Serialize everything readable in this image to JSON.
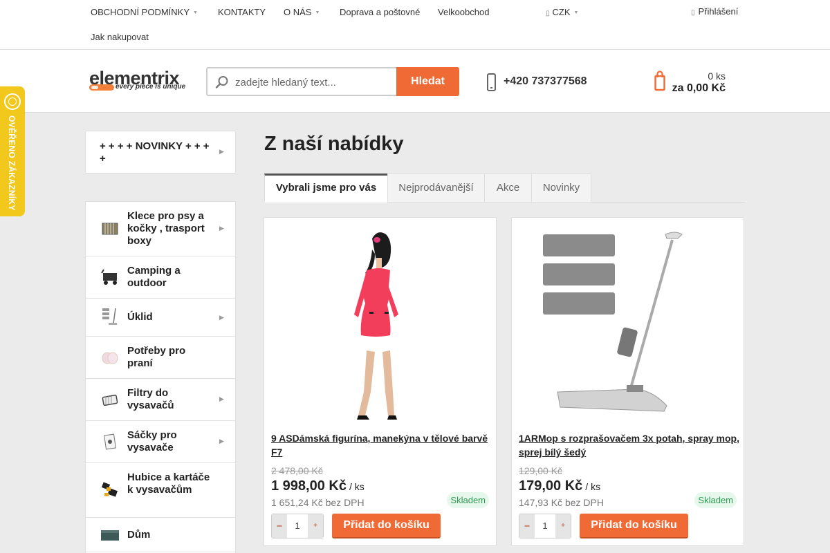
{
  "topnav": {
    "items": [
      {
        "label": "OBCHODNÍ PODMÍNKY",
        "has_dropdown": true
      },
      {
        "label": "KONTAKTY",
        "has_dropdown": false
      },
      {
        "label": "O NÁS",
        "has_dropdown": true
      },
      {
        "label": "Doprava a poštovné",
        "has_dropdown": false
      },
      {
        "label": "Velkoobchod",
        "has_dropdown": false
      },
      {
        "label": "Jak nakupovat",
        "has_dropdown": false
      }
    ],
    "currency": "CZK",
    "login": "Přihlášení"
  },
  "header": {
    "logo_text": "elementrix",
    "logo_tagline": "every piece is unique",
    "search_placeholder": "zadejte hledaný text...",
    "search_button": "Hledat",
    "phone": "+420 737377568",
    "cart_qty": "0 ks",
    "cart_total": "za 0,00 Kč"
  },
  "badge": {
    "text": "OVĚŘENO ZÁKAZNÍKY"
  },
  "sidebar": {
    "novinky": "+ + + + NOVINKY + + + +",
    "categories": [
      {
        "label": "Klece pro psy a kočky , trasport boxy",
        "icon": "cage-icon",
        "has_sub": true
      },
      {
        "label": "Camping a outdoor",
        "icon": "cart-wagon-icon",
        "has_sub": false
      },
      {
        "label": "Úklid",
        "icon": "mop-icon",
        "has_sub": true
      },
      {
        "label": "Potřeby pro praní",
        "icon": "laundry-bag-icon",
        "has_sub": false
      },
      {
        "label": "Filtry do vysavačů",
        "icon": "filter-icon",
        "has_sub": true
      },
      {
        "label": "Sáčky pro vysavače",
        "icon": "vacuum-bag-icon",
        "has_sub": true
      },
      {
        "label": "Hubice a kartáče k vysavačům",
        "icon": "brush-icon",
        "has_sub": false
      },
      {
        "label": "Dům",
        "icon": "storage-box-icon",
        "has_sub": false
      }
    ]
  },
  "main": {
    "title": "Z naší nabídky",
    "tabs": [
      "Vybrali jsme pro vás",
      "Nejprodávanější",
      "Akce",
      "Novinky"
    ],
    "active_tab": 0,
    "products": [
      {
        "name": "9 ASDámská figurína, manekýna v tělové barvě F7",
        "old_price": "2 478,00 Kč",
        "price": "1 998,00 Kč",
        "unit": "/ ks",
        "price_net": "1 651,24 Kč bez DPH",
        "stock": "Skladem",
        "qty": "1",
        "add_label": "Přidat do košíku",
        "image": "mannequin-red-dress-image"
      },
      {
        "name": "1ARMop s rozprašovačem 3x potah, spray mop, sprej bílý šedý",
        "old_price": "129,00 Kč",
        "price": "179,00 Kč",
        "unit": "/ ks",
        "price_net": "147,93 Kč bez DPH",
        "stock": "Skladem",
        "qty": "1",
        "add_label": "Přidat do košíku",
        "image": "spray-mop-image"
      }
    ]
  },
  "colors": {
    "accent": "#f06a35",
    "badge": "#f2c81d",
    "stock": "#2f9a52"
  }
}
